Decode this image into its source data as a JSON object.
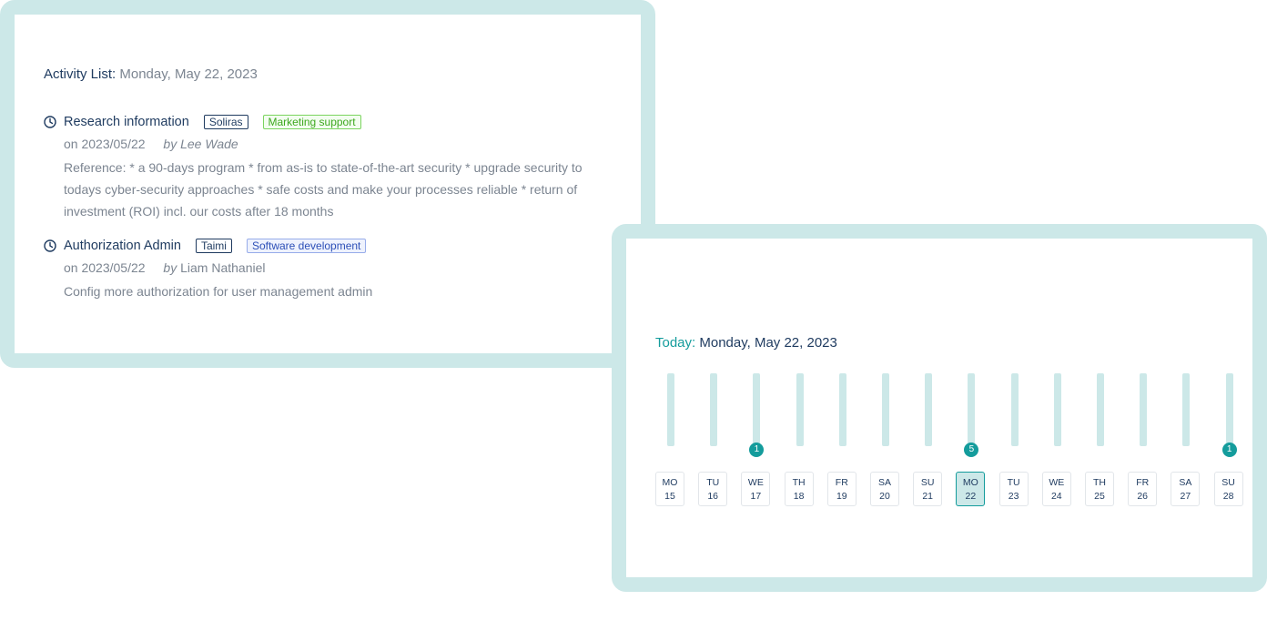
{
  "activity_list": {
    "label": "Activity List:",
    "date": "Monday, May 22, 2023",
    "items": [
      {
        "title": "Research information",
        "person_tag": "Soliras",
        "category_tag": "Marketing support",
        "on": "on 2023/05/22",
        "by_label": "by",
        "by_name": "Lee Wade",
        "description": "Reference: * a 90-days program * from as-is to state-of-the-art security * upgrade security to todays cyber-security approaches * safe costs and make your processes reliable * return of investment (ROI) incl. our costs after 18 months"
      },
      {
        "title": "Authorization Admin",
        "person_tag": "Taimi",
        "category_tag": "Software development",
        "on": "on 2023/05/22",
        "by_label": "by",
        "by_name": "Liam Nathaniel",
        "description": "Config more authorization for user management admin"
      }
    ]
  },
  "calendar": {
    "today_label": "Today:",
    "today_date": "Monday, May 22, 2023",
    "days": [
      {
        "abbr": "MO",
        "num": "15",
        "badge": ""
      },
      {
        "abbr": "TU",
        "num": "16",
        "badge": ""
      },
      {
        "abbr": "WE",
        "num": "17",
        "badge": "1"
      },
      {
        "abbr": "TH",
        "num": "18",
        "badge": ""
      },
      {
        "abbr": "FR",
        "num": "19",
        "badge": ""
      },
      {
        "abbr": "SA",
        "num": "20",
        "badge": ""
      },
      {
        "abbr": "SU",
        "num": "21",
        "badge": ""
      },
      {
        "abbr": "MO",
        "num": "22",
        "badge": "5",
        "selected": true
      },
      {
        "abbr": "TU",
        "num": "23",
        "badge": ""
      },
      {
        "abbr": "WE",
        "num": "24",
        "badge": ""
      },
      {
        "abbr": "TH",
        "num": "25",
        "badge": ""
      },
      {
        "abbr": "FR",
        "num": "26",
        "badge": ""
      },
      {
        "abbr": "SA",
        "num": "27",
        "badge": ""
      },
      {
        "abbr": "SU",
        "num": "28",
        "badge": "1"
      }
    ]
  },
  "colors": {
    "frame": "#cce8e8",
    "accent": "#149c9c",
    "text_primary": "#1e3a5f",
    "text_muted": "#7c8591",
    "tag_green": "#3da81f",
    "tag_blue": "#2c4fb7"
  },
  "icons": {
    "activity": "clock-icon"
  }
}
